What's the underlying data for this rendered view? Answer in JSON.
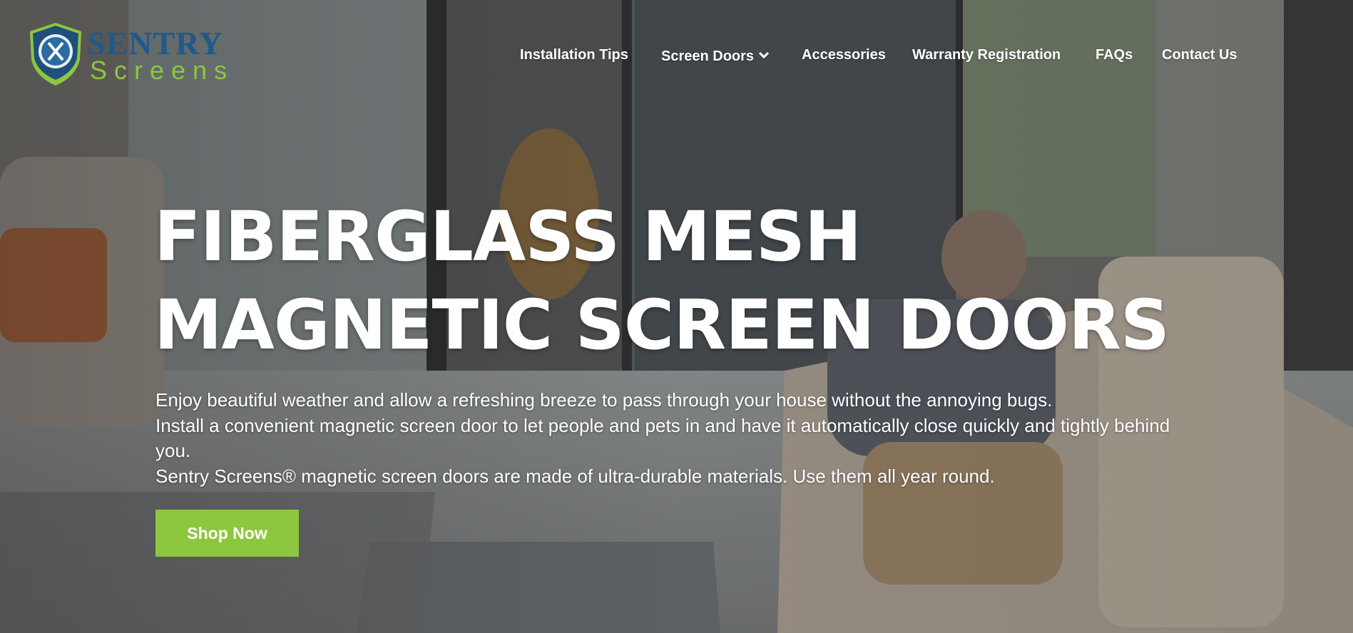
{
  "brand": {
    "name_line1": "SENTRY",
    "name_line2": "Screens",
    "colors": {
      "primary_blue": "#1f5a8a",
      "accent_green": "#8dc63f"
    }
  },
  "nav": {
    "items": [
      {
        "label": "Installation Tips"
      },
      {
        "label": "Screen Doors",
        "has_dropdown": true,
        "icon": "chevron-down-icon"
      },
      {
        "label": "Accessories"
      },
      {
        "label": "Warranty Registration"
      },
      {
        "label": "FAQs"
      },
      {
        "label": "Contact Us"
      }
    ]
  },
  "hero": {
    "title_line1": "FIBERGLASS MESH",
    "title_line2": "MAGNETIC SCREEN DOORS",
    "description": [
      "Enjoy beautiful weather and allow a refreshing breeze to pass through your house without the annoying bugs.",
      "Install a convenient magnetic screen door to let people and pets in and have it automatically close quickly and tightly behind you.",
      "Sentry Screens® magnetic screen doors are made of ultra-durable materials. Use them all year round."
    ],
    "cta_label": "Shop Now",
    "cta_color": "#8dc63f"
  }
}
